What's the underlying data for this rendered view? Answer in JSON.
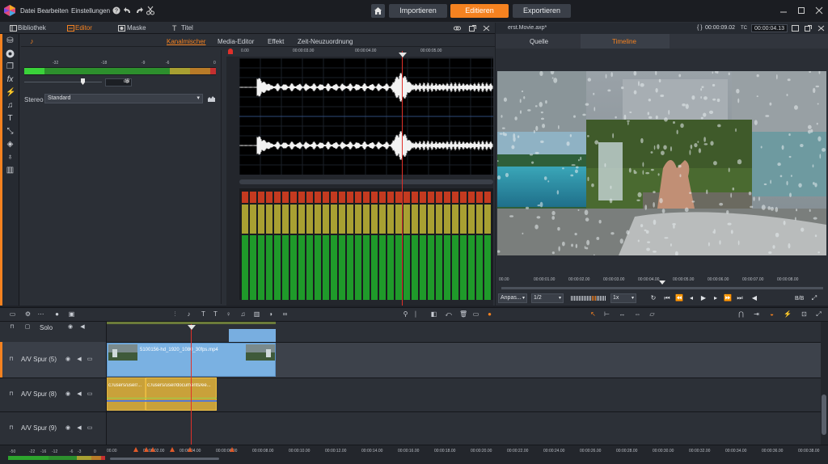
{
  "menu": {
    "file": "Datei",
    "edit": "Bearbeiten",
    "settings": "Einstellungen"
  },
  "nav": {
    "import": "Importieren",
    "edit": "Editieren",
    "export": "Exportieren"
  },
  "panel_tabs": {
    "library": "Bibliothek",
    "editor": "Editor",
    "mask": "Maske",
    "title": "Titel"
  },
  "editor_tabs": {
    "mixer": "Kanalmischer",
    "media_editor": "Media-Editor",
    "effect": "Effekt",
    "time_remap": "Zeit-Neuzuordnung"
  },
  "mixer": {
    "scale": [
      "-32",
      "-18",
      "-9",
      "-6",
      "0"
    ],
    "volume_value": "0",
    "volume_unit": "dB",
    "stereo_label": "Stereo",
    "stereo_value": "Standard"
  },
  "wave_ruler": [
    "0.00",
    "00:00:03.00",
    "00:00:04.00",
    "00:00:05.00"
  ],
  "preview": {
    "filename": "erst.Movie.axp*",
    "tc_main": "00:00:09.02",
    "tc_label": "TC",
    "tc_current": "00:00:04.13",
    "tab_source": "Quelle",
    "tab_timeline": "Timeline",
    "ruler": [
      "00.00",
      "00:00:01.00",
      "00:00:02.00",
      "00:00:03.00",
      "00:00:04.00",
      "00:00:05.00",
      "00:00:06.00",
      "00:00:07.00",
      "00:00:08.00"
    ],
    "fit_label": "Anpas...",
    "ratio": "1/2",
    "speed": "1x",
    "bb_label": "B/B"
  },
  "tracks": {
    "solo_label": "Solo",
    "track1": "A/V Spur (5)",
    "track2": "A/V Spur (8)",
    "track3": "A/V Spur (9)",
    "video_clip": "5100156-hd_1920_1080_30fps.mp4",
    "audio_clip1": "c:/users/user/...",
    "audio_clip2": "c:/users/user/documents/ee..."
  },
  "bottom": {
    "scale": [
      "-50",
      "-22",
      "-16",
      "-12",
      "-6",
      "-3",
      "0"
    ],
    "ruler": [
      "00.00",
      "00:00:02.00",
      "00:00:04.00",
      "00:00:06.00",
      "00:00:08.00",
      "00:00:10.00",
      "00:00:12.00",
      "00:00:14.00",
      "00:00:16.00",
      "00:00:18.00",
      "00:00:20.00",
      "00:00:22.00",
      "00:00:24.00",
      "00:00:26.00",
      "00:00:28.00",
      "00:00:30.00",
      "00:00:32.00",
      "00:00:34.00",
      "00:00:36.00",
      "00:00:38.00"
    ]
  },
  "colors": {
    "accent": "#f58220",
    "bg": "#1e2127",
    "panel": "#2b2f36",
    "playhead": "#e0302a"
  }
}
